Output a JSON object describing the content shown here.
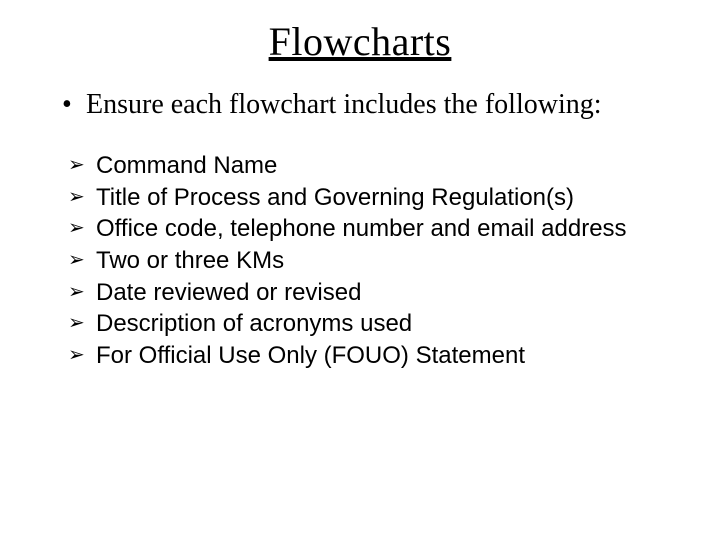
{
  "title": "Flowcharts",
  "lead": "Ensure each flowchart includes the following:",
  "items": [
    "Command Name",
    "Title of Process and Governing Regulation(s)",
    "Office code, telephone number and email address",
    "Two or three KMs",
    "Date reviewed or revised",
    "Description of acronyms used",
    "For Official Use Only (FOUO) Statement"
  ]
}
